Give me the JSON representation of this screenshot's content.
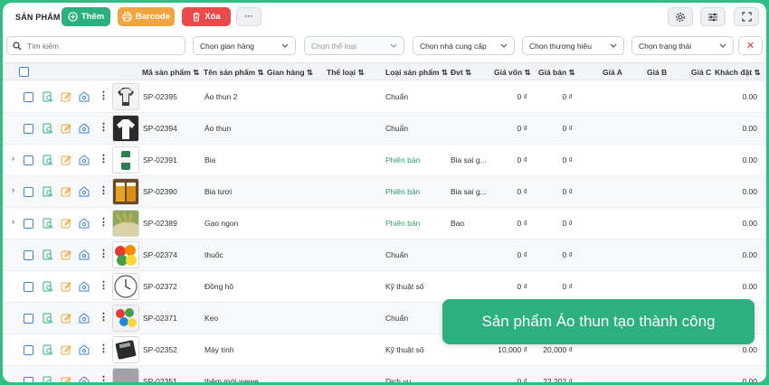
{
  "header": {
    "title": "SẢN PHẨM",
    "add_label": "Thêm",
    "barcode_label": "Barcode",
    "delete_label": "Xóa",
    "more_label": "···"
  },
  "filters": {
    "search_placeholder": "Tìm kiếm",
    "store": "Chọn gian hàng",
    "category": "Chọn thể loại",
    "supplier": "Chọn nhà cung cấp",
    "brand": "Chọn thương hiệu",
    "status": "Chọn trạng thái"
  },
  "columns": {
    "code": "Mã sản phẩm ⇅",
    "name": "Tên sản phẩm ⇅",
    "store": "Gian hàng ⇅",
    "category": "Thể loại ⇅",
    "type": "Loại sản phẩm ⇅",
    "unit": "Đvt ⇅",
    "cost": "Giá vốn ⇅",
    "price": "Giá bán ⇅",
    "price_a": "Giá A",
    "price_b": "Giá B",
    "price_c": "Giá C",
    "customer_order": "Khách đặt ⇅"
  },
  "rows": [
    {
      "code": "SP-02395",
      "name": "Áo thun 2",
      "type": "Chuẩn",
      "unit": "",
      "cost": "0 ₫",
      "price": "0 ₫",
      "ordered": "0.00",
      "expand": "",
      "thumb": "white-shirt"
    },
    {
      "code": "SP-02394",
      "name": "Áo thun",
      "type": "Chuẩn",
      "unit": "",
      "cost": "0 ₫",
      "price": "0 ₫",
      "ordered": "0.00",
      "expand": "",
      "thumb": "shirt"
    },
    {
      "code": "SP-02391",
      "name": "Bia",
      "type": "Phiên bản",
      "unit": "Bia sai g...",
      "cost": "0 ₫",
      "price": "0 ₫",
      "ordered": "0.00",
      "expand": "›",
      "thumb": "beer-can"
    },
    {
      "code": "SP-02390",
      "name": "Bia tươi",
      "type": "Phiên bản",
      "unit": "Bia sai g...",
      "cost": "0 ₫",
      "price": "0 ₫",
      "ordered": "0.00",
      "expand": "›",
      "thumb": "beer-glass"
    },
    {
      "code": "SP-02389",
      "name": "Gạo ngon",
      "type": "Phiên bản",
      "unit": "Bao",
      "cost": "0 ₫",
      "price": "0 ₫",
      "ordered": "0.00",
      "expand": "›",
      "thumb": "rice"
    },
    {
      "code": "SP-02374",
      "name": "thuốc",
      "type": "Chuẩn",
      "unit": "",
      "cost": "0 ₫",
      "price": "0 ₫",
      "ordered": "0.00",
      "expand": "",
      "thumb": "fruits"
    },
    {
      "code": "SP-02372",
      "name": "Đồng hồ",
      "type": "Kỹ thuật số",
      "unit": "",
      "cost": "0 ₫",
      "price": "0 ₫",
      "ordered": "0.00",
      "expand": "",
      "thumb": "clock"
    },
    {
      "code": "SP-02371",
      "name": "Kẹo",
      "type": "Chuẩn",
      "unit": "",
      "cost": "",
      "price": "",
      "ordered": "",
      "expand": "",
      "thumb": "candy"
    },
    {
      "code": "SP-02352",
      "name": "Máy tính",
      "type": "Kỹ thuật số",
      "unit": "",
      "cost": "10,000 ₫",
      "price": "20,000 ₫",
      "ordered": "0.00",
      "expand": "",
      "thumb": "calculator"
    },
    {
      "code": "SP-02351",
      "name": "thêm mới wewe",
      "type": "Dịch vụ",
      "unit": "",
      "cost": "0 ₫",
      "price": "22,202 ₫",
      "ordered": "0.00",
      "expand": "",
      "thumb": "gray"
    }
  ],
  "toast": {
    "message": "Sản phẩm Áo thun tạo thành công"
  },
  "colors": {
    "primary": "#2db07f",
    "warning": "#f0a640",
    "danger": "#ea4a4a",
    "variant_text": "#2f9e6a"
  }
}
